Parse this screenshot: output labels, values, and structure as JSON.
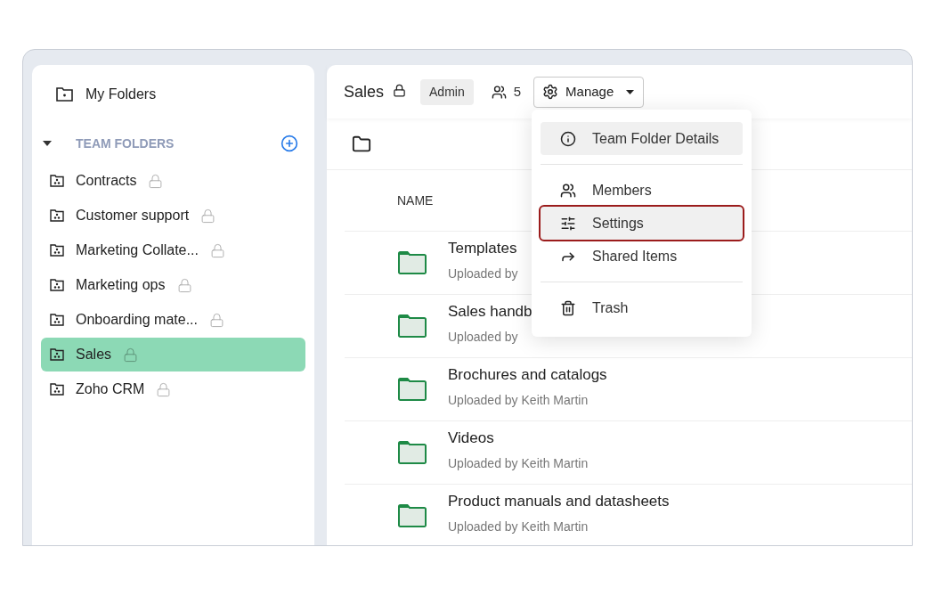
{
  "sidebar": {
    "my_folders": "My Folders",
    "section": {
      "title": "TEAM FOLDERS",
      "expanded": true
    },
    "items": [
      {
        "label": "Contracts",
        "locked": true,
        "selected": false
      },
      {
        "label": "Customer support",
        "locked": true,
        "selected": false
      },
      {
        "label": "Marketing Collate...",
        "locked": true,
        "selected": false
      },
      {
        "label": "Marketing ops",
        "locked": true,
        "selected": false
      },
      {
        "label": "Onboarding mate...",
        "locked": true,
        "selected": false
      },
      {
        "label": "Sales",
        "locked": true,
        "selected": true
      },
      {
        "label": "Zoho CRM",
        "locked": true,
        "selected": false
      }
    ]
  },
  "header": {
    "title": "Sales",
    "locked": true,
    "role": "Admin",
    "members": "5",
    "manage": "Manage"
  },
  "table": {
    "columns": [
      "NAME"
    ],
    "rows": [
      {
        "name": "Templates",
        "uploader": "Uploaded by"
      },
      {
        "name": "Sales handb",
        "uploader": "Uploaded by"
      },
      {
        "name": "Brochures and catalogs",
        "uploader": "Uploaded by Keith Martin"
      },
      {
        "name": "Videos",
        "uploader": "Uploaded by Keith Martin"
      },
      {
        "name": "Product manuals and datasheets",
        "uploader": "Uploaded by Keith Martin"
      }
    ]
  },
  "menu": {
    "groups": [
      [
        {
          "kind": "info",
          "label": "Team Folder Details",
          "highlighted": true,
          "outlined": false
        }
      ],
      [
        {
          "kind": "members",
          "label": "Members",
          "highlighted": false,
          "outlined": false
        },
        {
          "kind": "settings",
          "label": "Settings",
          "highlighted": true,
          "outlined": true
        },
        {
          "kind": "share",
          "label": "Shared Items",
          "highlighted": false,
          "outlined": false
        }
      ],
      [
        {
          "kind": "trash",
          "label": "Trash",
          "highlighted": false,
          "outlined": false
        }
      ]
    ]
  }
}
